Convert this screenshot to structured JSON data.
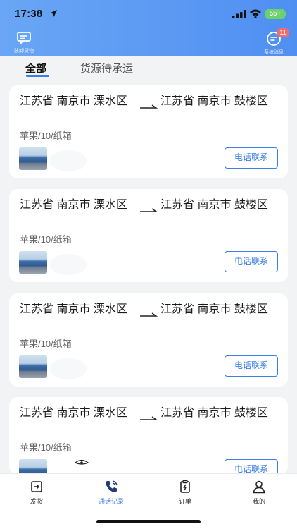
{
  "status_bar": {
    "time": "17:38",
    "battery": "55+"
  },
  "header": {
    "left_label": "装卸货物",
    "right_label": "系统消息",
    "badge": "11",
    "background_color": "#5b99f3"
  },
  "tabs": [
    {
      "label": "全部",
      "active": true
    },
    {
      "label": "货源待承运",
      "active": false
    }
  ],
  "cards": [
    {
      "from": "江苏省 南京市 溧水区",
      "to": "江苏省 南京市 鼓楼区",
      "goods": "苹果/10/纸箱",
      "call_label": "电话联系"
    },
    {
      "from": "江苏省 南京市 溧水区",
      "to": "江苏省 南京市 鼓楼区",
      "goods": "苹果/10/纸箱",
      "call_label": "电话联系"
    },
    {
      "from": "江苏省 南京市 溧水区",
      "to": "江苏省 南京市 鼓楼区",
      "goods": "苹果/10/纸箱",
      "call_label": "电话联系"
    },
    {
      "from": "江苏省 南京市 溧水区",
      "to": "江苏省 南京市 鼓楼区",
      "goods": "苹果/10/纸箱",
      "call_label": "电话联系"
    }
  ],
  "tabbar": [
    {
      "label": "发货",
      "icon": "ship-icon",
      "active": false
    },
    {
      "label": "通话记录",
      "icon": "phone-icon",
      "active": true
    },
    {
      "label": "订单",
      "icon": "clipboard-icon",
      "active": false
    },
    {
      "label": "我的",
      "icon": "user-icon",
      "active": false
    }
  ],
  "colors": {
    "accent": "#3b7fe8",
    "badge": "#f36b6b",
    "battery": "#6bd16a"
  }
}
